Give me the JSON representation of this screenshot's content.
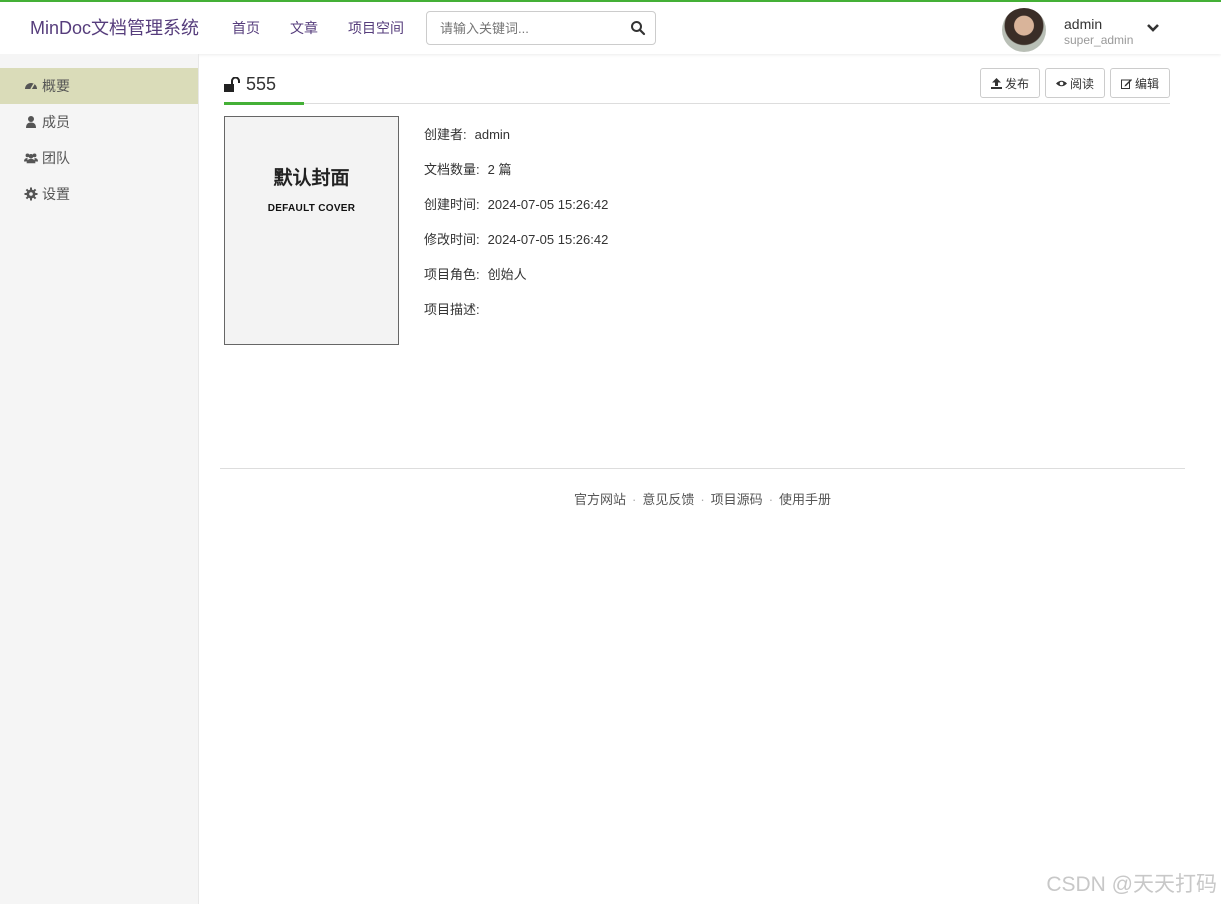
{
  "header": {
    "brand": "MinDoc文档管理系统",
    "nav": [
      "首页",
      "文章",
      "项目空间"
    ],
    "search_placeholder": "请输入关键词...",
    "user": {
      "name": "admin",
      "role": "super_admin"
    }
  },
  "sidebar": {
    "items": [
      {
        "label": "概要",
        "icon": "dashboard-icon",
        "active": true
      },
      {
        "label": "成员",
        "icon": "user-icon",
        "active": false
      },
      {
        "label": "团队",
        "icon": "users-icon",
        "active": false
      },
      {
        "label": "设置",
        "icon": "gear-icon",
        "active": false
      }
    ]
  },
  "project": {
    "title": "555",
    "buttons": {
      "publish": "发布",
      "read": "阅读",
      "edit": "编辑"
    },
    "cover": {
      "cn": "默认封面",
      "en": "DEFAULT COVER"
    },
    "info": [
      {
        "label": "创建者:",
        "value": "admin"
      },
      {
        "label": "文档数量:",
        "value": "2 篇"
      },
      {
        "label": "创建时间:",
        "value": "2024-07-05 15:26:42"
      },
      {
        "label": "修改时间:",
        "value": "2024-07-05 15:26:42"
      },
      {
        "label": "项目角色:",
        "value": "创始人"
      },
      {
        "label": "项目描述:",
        "value": ""
      }
    ]
  },
  "footer": {
    "links": [
      "官方网站",
      "意见反馈",
      "项目源码",
      "使用手册"
    ],
    "separator": "·"
  },
  "watermark": "CSDN @天天打码",
  "colors": {
    "accent": "#44B036",
    "brand": "#563D7C",
    "active_item": "#dadcb9"
  }
}
